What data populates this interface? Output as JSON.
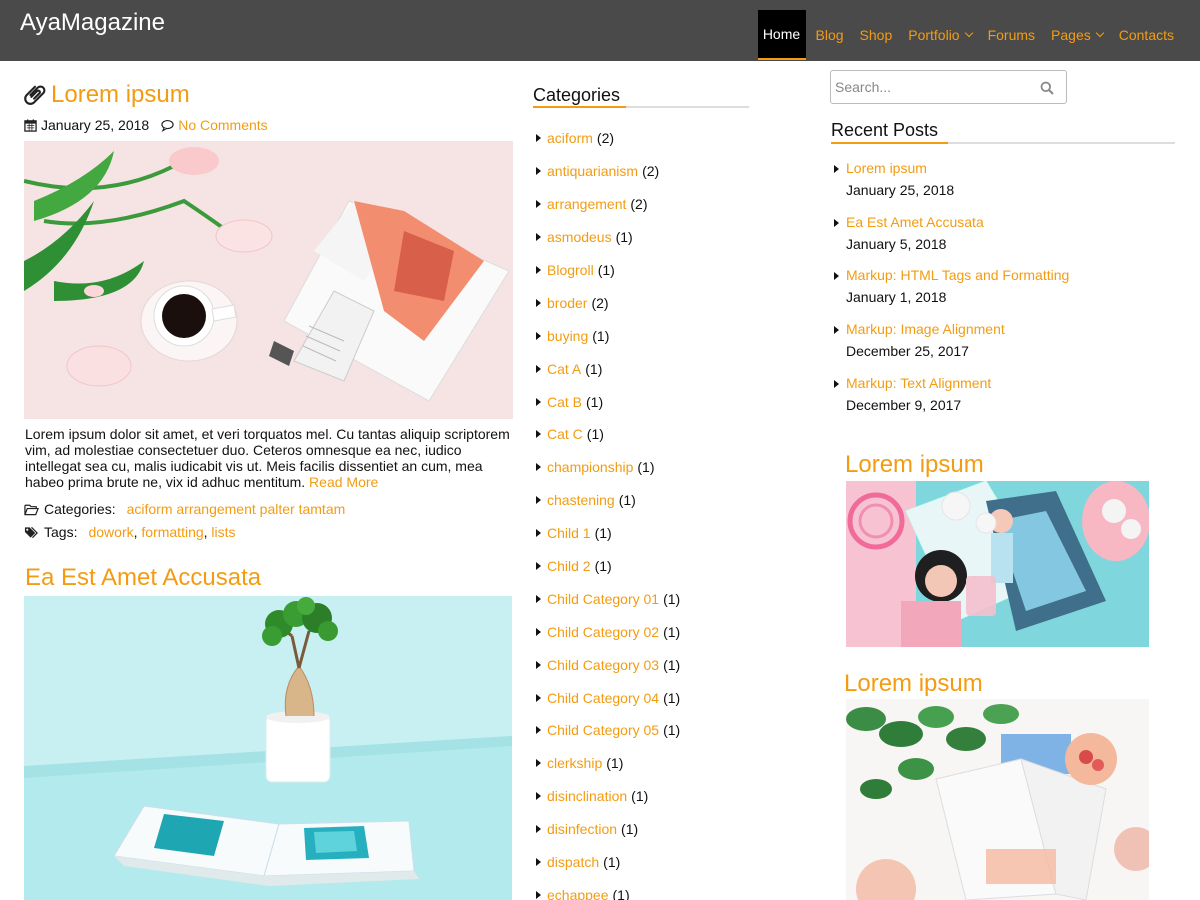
{
  "header": {
    "site_title": "AyaMagazine",
    "nav": [
      {
        "label": "Home",
        "active": true
      },
      {
        "label": "Blog"
      },
      {
        "label": "Shop"
      },
      {
        "label": "Portfolio",
        "dropdown": true
      },
      {
        "label": "Forums"
      },
      {
        "label": "Pages",
        "dropdown": true
      },
      {
        "label": "Contacts"
      }
    ]
  },
  "colors": {
    "accent": "#f39c12",
    "header_bg": "#4a4a4a",
    "active_nav_bg": "#000000"
  },
  "posts": [
    {
      "title": "Lorem ipsum",
      "title_icon": "paperclip-icon",
      "date": "January 25, 2018",
      "comments": "No Comments",
      "image_desc_icon": "image",
      "excerpt": "Lorem ipsum dolor sit amet, et veri torquatos mel. Cu tantas aliquip scriptorem vim, ad molestiae consectetuer duo. Ceteros omnesque ea nec, iudico intellegat sea cu, malis iudicabit vis ut. Meis facilis dissentiet an cum, mea habeo prima brute ne, vix id adhuc mentitum.",
      "read_more": "Read More",
      "categories_label": "Categories:",
      "categories": [
        "aciform",
        "arrangement",
        "palter",
        "tamtam"
      ],
      "tags_label": "Tags:",
      "tags": [
        "dowork",
        "formatting",
        "lists"
      ]
    },
    {
      "title": "Ea Est Amet Accusata"
    }
  ],
  "categories_widget": {
    "title": "Categories",
    "items": [
      {
        "name": "aciform",
        "count": "(2)"
      },
      {
        "name": "antiquarianism",
        "count": "(2)"
      },
      {
        "name": "arrangement",
        "count": "(2)"
      },
      {
        "name": "asmodeus",
        "count": "(1)"
      },
      {
        "name": "Blogroll",
        "count": "(1)"
      },
      {
        "name": "broder",
        "count": "(2)"
      },
      {
        "name": "buying",
        "count": "(1)"
      },
      {
        "name": "Cat A",
        "count": "(1)"
      },
      {
        "name": "Cat B",
        "count": "(1)"
      },
      {
        "name": "Cat C",
        "count": "(1)"
      },
      {
        "name": "championship",
        "count": "(1)"
      },
      {
        "name": "chastening",
        "count": "(1)"
      },
      {
        "name": "Child 1",
        "count": "(1)"
      },
      {
        "name": "Child 2",
        "count": "(1)"
      },
      {
        "name": "Child Category 01",
        "count": "(1)"
      },
      {
        "name": "Child Category 02",
        "count": "(1)"
      },
      {
        "name": "Child Category 03",
        "count": "(1)"
      },
      {
        "name": "Child Category 04",
        "count": "(1)"
      },
      {
        "name": "Child Category 05",
        "count": "(1)"
      },
      {
        "name": "clerkship",
        "count": "(1)"
      },
      {
        "name": "disinclination",
        "count": "(1)"
      },
      {
        "name": "disinfection",
        "count": "(1)"
      },
      {
        "name": "dispatch",
        "count": "(1)"
      },
      {
        "name": "echappee",
        "count": "(1)"
      }
    ]
  },
  "sidebar": {
    "search_placeholder": "Search...",
    "recent_title": "Recent Posts",
    "recent_posts": [
      {
        "title": "Lorem ipsum",
        "date": "January 25, 2018"
      },
      {
        "title": "Ea Est Amet Accusata",
        "date": "January 5, 2018"
      },
      {
        "title": "Markup: HTML Tags and Formatting",
        "date": "January 1, 2018"
      },
      {
        "title": "Markup: Image Alignment",
        "date": "December 25, 2017"
      },
      {
        "title": "Markup: Text Alignment",
        "date": "December 9, 2017"
      }
    ],
    "featured": [
      {
        "title": "Lorem ipsum"
      },
      {
        "title": "Lorem ipsum"
      }
    ]
  }
}
